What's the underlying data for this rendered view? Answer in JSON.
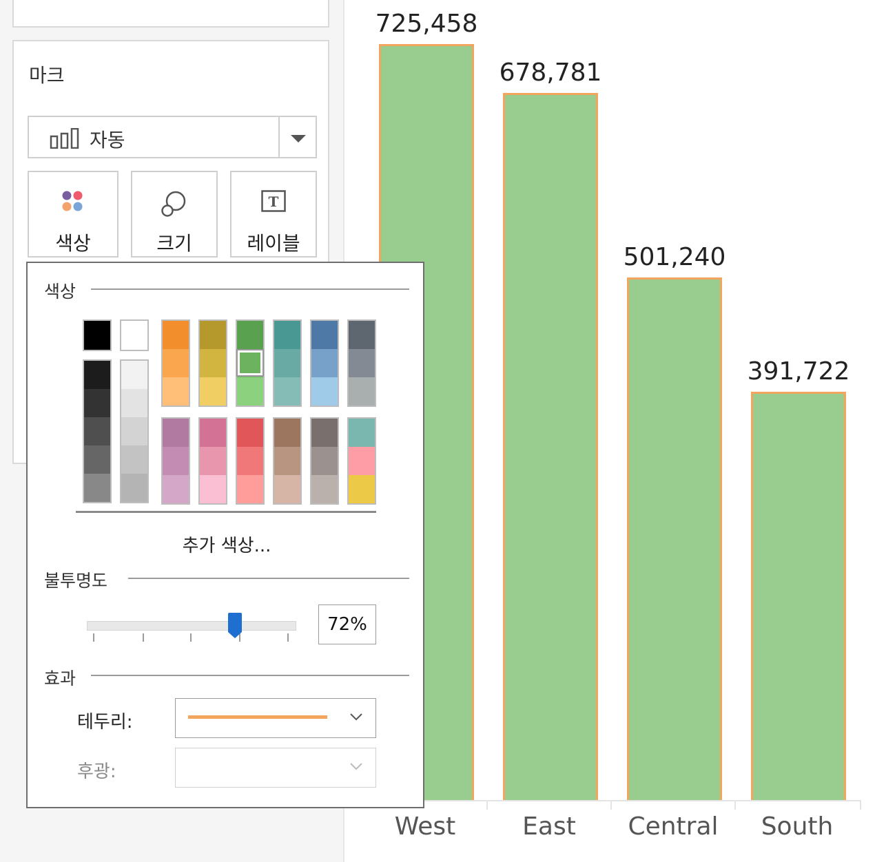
{
  "marks_card": {
    "title": "마크",
    "mark_type": "자동",
    "buttons": [
      {
        "label": "색상",
        "icon": "color-dots-icon"
      },
      {
        "label": "크기",
        "icon": "size-circles-icon"
      },
      {
        "label": "레이블",
        "icon": "text-label-icon"
      }
    ]
  },
  "chart_data": {
    "type": "bar",
    "categories": [
      "West",
      "East",
      "Central",
      "South"
    ],
    "values": [
      725458,
      678781,
      501240,
      391722
    ],
    "value_labels": [
      "725,458",
      "678,781",
      "501,240",
      "391,722"
    ],
    "bar_fill": "#99cc8f",
    "bar_border": "#f4a55d",
    "title": "",
    "xlabel": "",
    "ylabel": ""
  },
  "color_popover": {
    "color_section_title": "색상",
    "more_colors": "추가 색상...",
    "opacity_title": "불투명도",
    "opacity_value": "72%",
    "opacity_level": 0.72,
    "effects_title": "효과",
    "border_label": "테두리:",
    "border_color": "#f4a55d",
    "halo_label": "후광:",
    "selected_color": "#6db35f",
    "palette": {
      "single_black": "#000000",
      "single_white": "#ffffff",
      "gray_dark": [
        "#1c1c1c",
        "#333333",
        "#4f4f4f",
        "#666666",
        "#888888"
      ],
      "gray_light": [
        "#f2f2f2",
        "#e3e3e3",
        "#d3d3d3",
        "#c3c3c3",
        "#b4b4b4"
      ],
      "top_columns": [
        [
          "#f28e2b",
          "#f9a64f",
          "#ffbf79"
        ],
        [
          "#b6992d",
          "#d2b441",
          "#f1ce63"
        ],
        [
          "#59a14f",
          "#6db35f",
          "#8cd17d"
        ],
        [
          "#499894",
          "#6aaaa4",
          "#86bcb6"
        ],
        [
          "#4e79a7",
          "#77a1c8",
          "#a0cbe8"
        ],
        [
          "#5e6770",
          "#838a93",
          "#a9aeaf"
        ]
      ],
      "bottom_columns": [
        [
          "#b07aa1",
          "#c38db3",
          "#d4a6c8"
        ],
        [
          "#d37295",
          "#e796ad",
          "#fabfd2"
        ],
        [
          "#e15759",
          "#f07878",
          "#ff9d9a"
        ],
        [
          "#9d7660",
          "#b89581",
          "#d7b5a6"
        ],
        [
          "#79706e",
          "#9b918e",
          "#bab0ac"
        ],
        [
          "#79b7af",
          "#ff9da7",
          "#edc948"
        ]
      ]
    }
  }
}
